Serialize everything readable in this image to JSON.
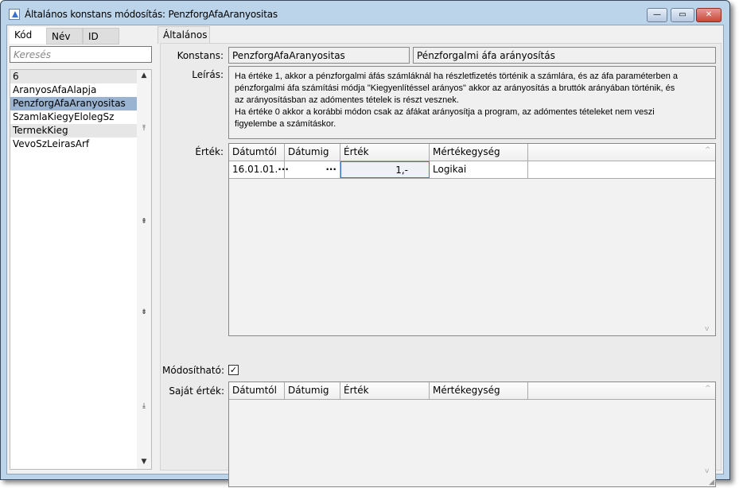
{
  "window": {
    "title": "Általános konstans módosítás: PenzforgAfaAranyositas",
    "minimize": "—",
    "maximize": "▭",
    "close": "✕",
    "close_color": "#c9473b"
  },
  "left": {
    "tabs": [
      "Kód",
      "Név",
      "ID"
    ],
    "search_placeholder": "Keresés",
    "items": [
      "6",
      "AranyosAfaAlapja",
      "PenzforgAfaAranyositas",
      "SzamlaKiegyElolegSz",
      "TermekKieg",
      "VevoSzLeirasArf"
    ]
  },
  "right": {
    "tab": "Általános",
    "konstans_label": "Konstans:",
    "konstans_code": "PenzforgAfaAranyositas",
    "konstans_name": "Pénzforgalmi áfa arányosítás",
    "leiras_label": "Leírás:",
    "leiras_lines": [
      "Ha értéke 1, akkor a pénzforgalmi áfás számláknál ha részletfizetés történik a számlára, és az áfa paraméterben a",
      "pénzforgalmi áfa számítási módja \"Kiegyenlítéssel arányos\"  akkor az arányosítás a bruttók arányában történik, és",
      "az arányosításban az adómentes tételek is részt vesznek.",
      "Ha értéke 0 akkor a korábbi módon csak az áfákat arányosítja a program, az adómentes tételeket nem veszi",
      "figyelembe a számításkor."
    ],
    "ertek_label": "Érték:",
    "sajat_label": "Saját érték:",
    "modosithato_label": "Módosítható:",
    "modosithato_checked": true,
    "columns": [
      "Dátumtól",
      "Dátumig",
      "Érték",
      "Mértékegység"
    ],
    "rows": [
      {
        "datumtol": "16.01.01.",
        "datumig": "",
        "ertek": "1,-",
        "mertekegyseg": "Logikai"
      }
    ],
    "ellipsis": "···"
  }
}
